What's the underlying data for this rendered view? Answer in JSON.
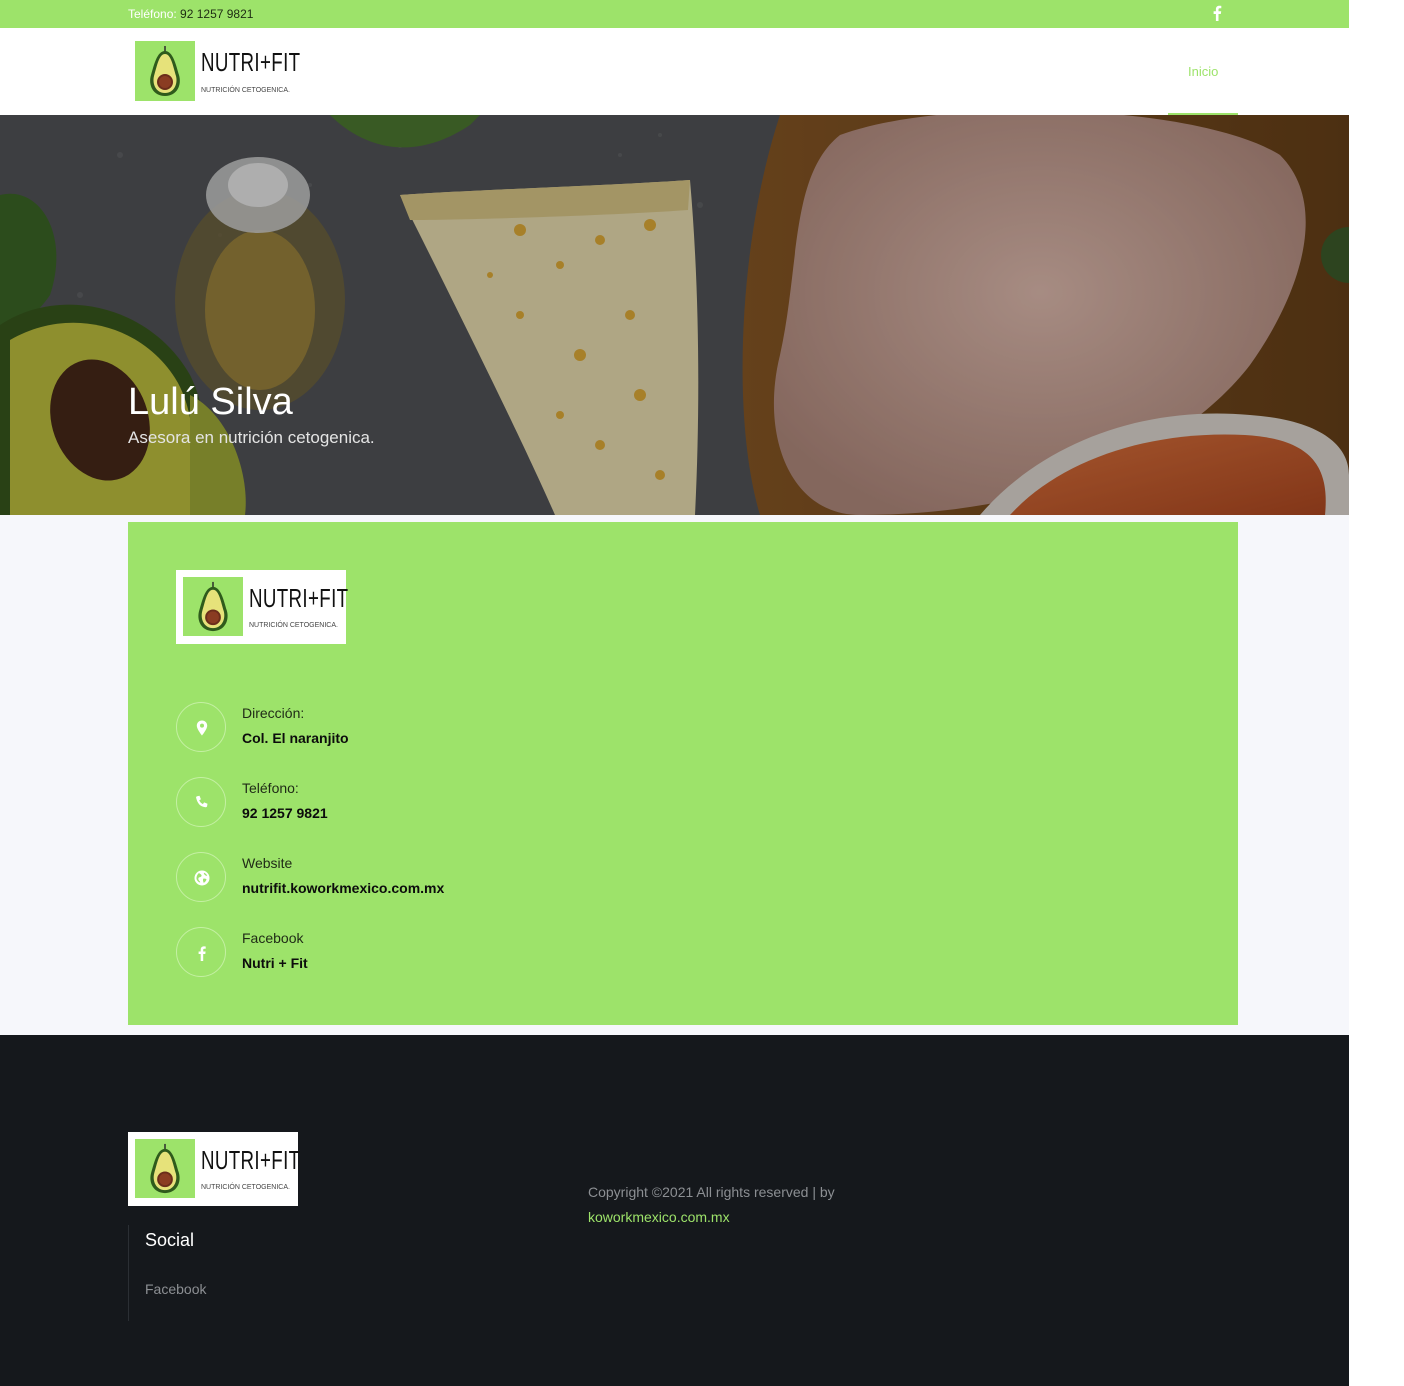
{
  "topbar": {
    "phone_label": "Teléfono:",
    "phone_number": "92 1257 9821",
    "social_icon": "facebook-icon"
  },
  "brand": {
    "name": "NUTRI+FIT",
    "tagline": "NUTRICIÓN CETOGENICA.",
    "logo_icon": "avocado-icon"
  },
  "nav": {
    "items": [
      {
        "label": "Inicio",
        "active": true
      }
    ]
  },
  "hero": {
    "title": "Lulú Silva",
    "subtitle": "Asesora en nutrición cetogenica."
  },
  "contact": {
    "items": [
      {
        "icon": "map-pin-icon",
        "label": "Dirección:",
        "value": "Col. El naranjito"
      },
      {
        "icon": "phone-icon",
        "label": "Teléfono:",
        "value": "92 1257 9821"
      },
      {
        "icon": "globe-icon",
        "label": "Website",
        "value": "nutrifit.koworkmexico.com.mx"
      },
      {
        "icon": "facebook-icon",
        "label": "Facebook",
        "value": "Nutri + Fit"
      }
    ]
  },
  "footer": {
    "social_title": "Social",
    "social_links": [
      "Facebook"
    ],
    "copyright": "Copyright ©2021 All rights reserved | by",
    "copyright_link": "koworkmexico.com.mx"
  },
  "colors": {
    "accent_green": "#9de36a",
    "footer_bg": "#15181c",
    "band_bg": "#f6f7fb"
  }
}
